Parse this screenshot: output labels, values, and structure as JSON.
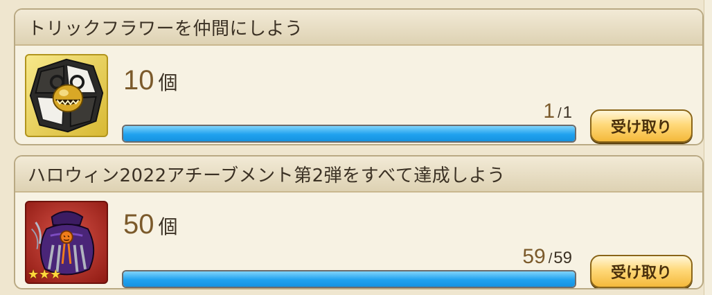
{
  "missions": [
    {
      "title": "トリックフラワーを仲間にしよう",
      "reward_amount": "10",
      "reward_unit": "個",
      "progress_current": "1",
      "progress_separator": "/",
      "progress_max": "1",
      "progress_fraction": 1.0,
      "claim_label": "受け取り",
      "icon": "trick-flower-monster-icon",
      "stars": 0
    },
    {
      "title": "ハロウィン2022アチーブメント第2弾をすべて達成しよう",
      "reward_amount": "50",
      "reward_unit": "個",
      "progress_current": "59",
      "progress_separator": "/",
      "progress_max": "59",
      "progress_fraction": 1.0,
      "claim_label": "受け取り",
      "icon": "halloween-pumpkin-bag-icon",
      "stars": 3
    }
  ],
  "colors": {
    "progress_fill": "#20a2ef",
    "button": "#ffd97a",
    "card_bg": "#f7f2e3",
    "amount": "#7b5a2b"
  }
}
